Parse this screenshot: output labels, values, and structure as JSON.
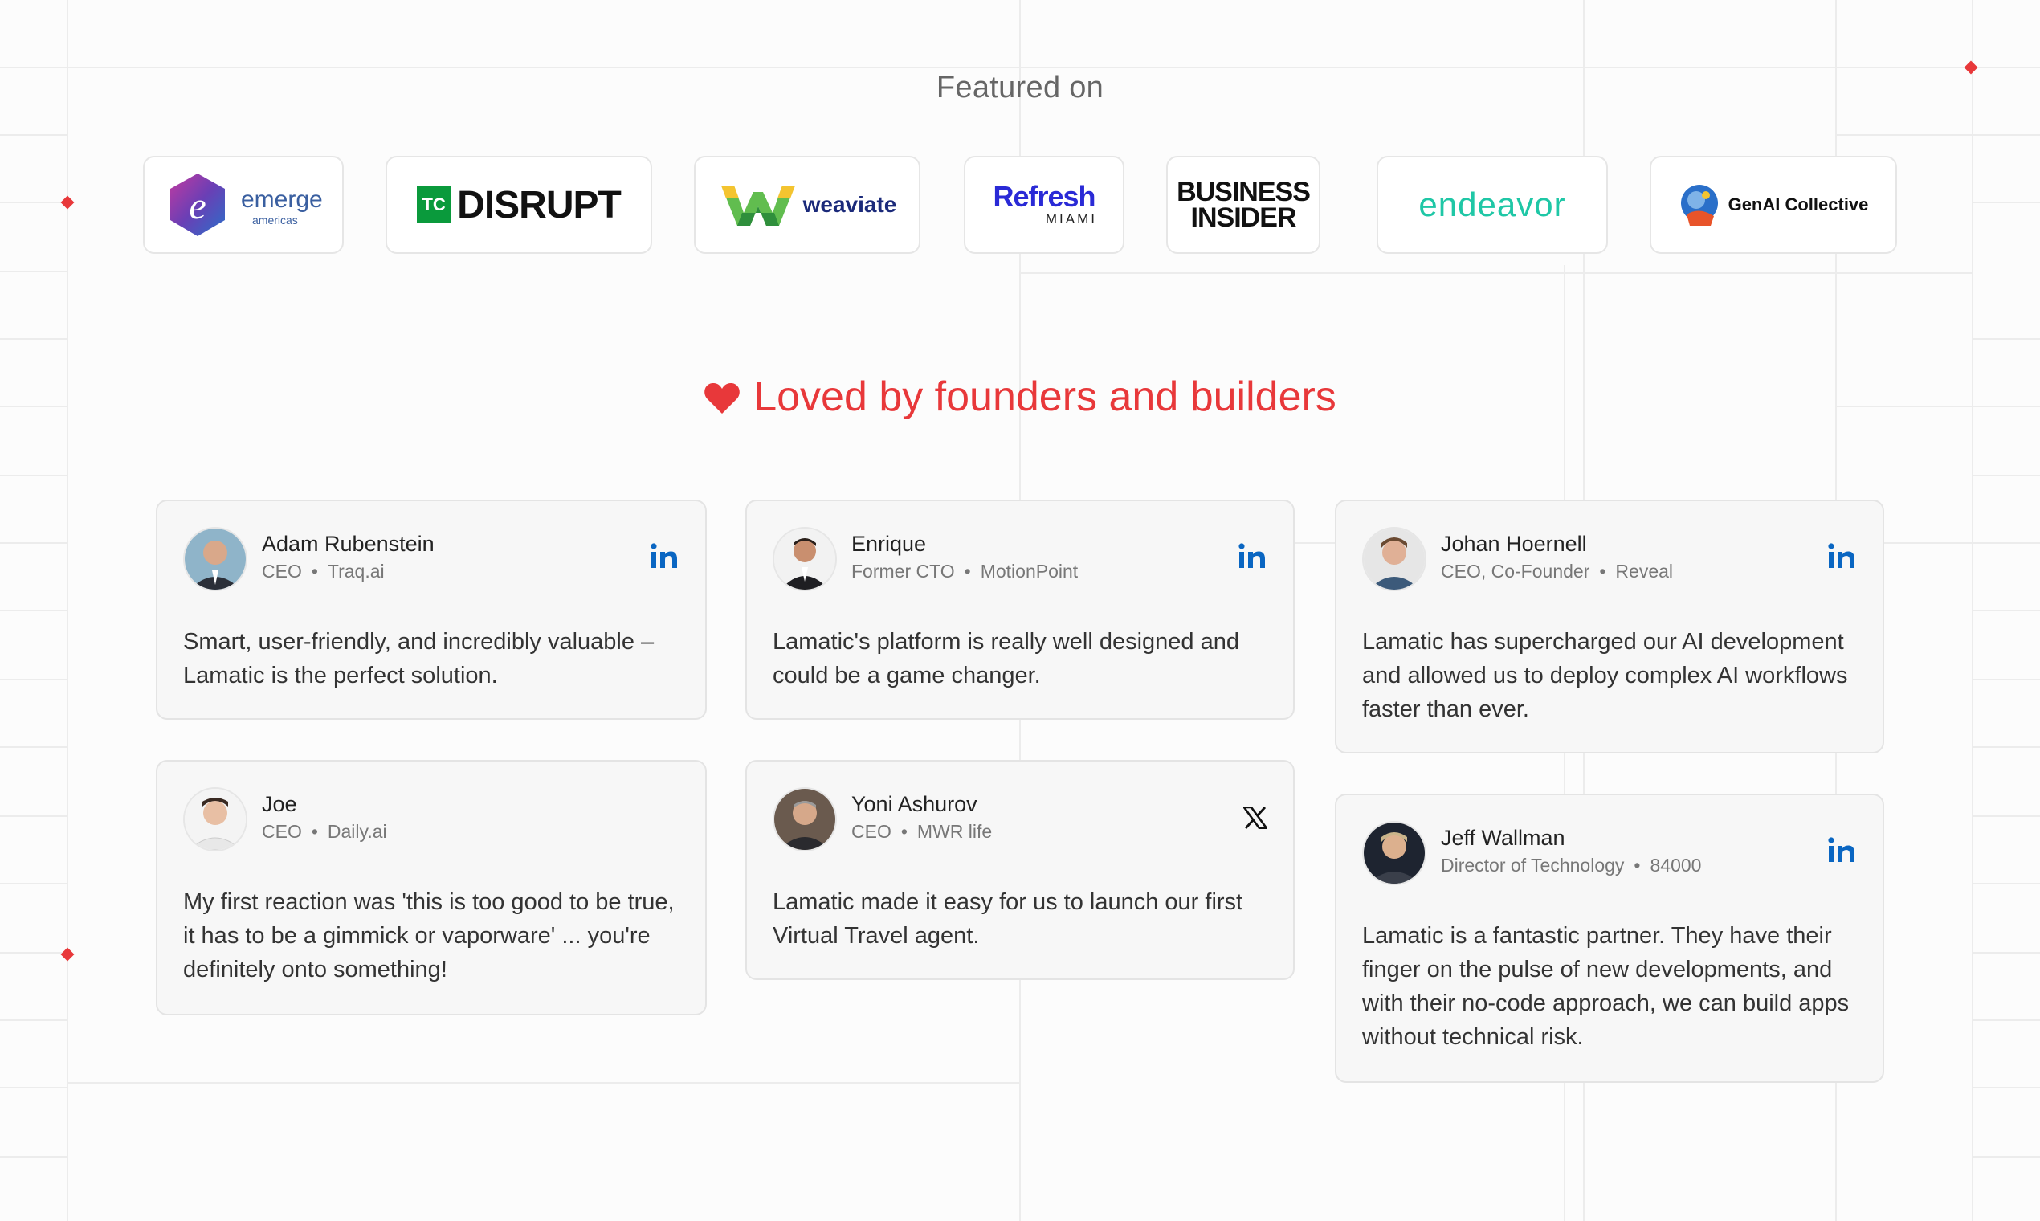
{
  "featured": {
    "title": "Featured on",
    "logos": [
      {
        "name": "emerge",
        "sub": "americas"
      },
      {
        "name": "DISRUPT",
        "badge": "TC"
      },
      {
        "name": "weaviate"
      },
      {
        "name": "Refresh",
        "sub": "MIAMI"
      },
      {
        "name": "BUSINESS",
        "name2": "INSIDER"
      },
      {
        "name": "endeavor"
      },
      {
        "name": "GenAI Collective"
      }
    ]
  },
  "testimonials": {
    "title": "Loved by founders and builders",
    "heart_color": "#e8383a",
    "items": [
      {
        "name": "Adam Rubenstein",
        "role": "CEO",
        "company": "Traq.ai",
        "social": "linkedin",
        "quote": "Smart, user-friendly, and incredibly valuable – Lamatic is the perfect solution."
      },
      {
        "name": "Enrique",
        "role": "Former CTO",
        "company": "MotionPoint",
        "social": "linkedin",
        "quote": "Lamatic's platform is really well designed and could be a game changer."
      },
      {
        "name": "Johan Hoernell",
        "role": "CEO, Co-Founder",
        "company": "Reveal",
        "social": "linkedin",
        "quote": "Lamatic has supercharged our AI development and allowed us to deploy complex AI workflows faster than ever."
      },
      {
        "name": "Joe",
        "role": "CEO",
        "company": "Daily.ai",
        "social": "none",
        "quote": "My first reaction was 'this is too good to be true, it has to be a gimmick or vaporware' ... you're definitely onto something!"
      },
      {
        "name": "Yoni Ashurov",
        "role": "CEO",
        "company": "MWR life",
        "social": "x",
        "quote": "Lamatic made it easy for us to launch our first Virtual Travel agent."
      },
      {
        "name": "Jeff Wallman",
        "role": "Director of Technology",
        "company": "84000",
        "social": "linkedin",
        "quote": "Lamatic is a fantastic partner. They have their finger on the pulse of new developments, and with their no-code approach, we can build apps without technical risk."
      }
    ]
  },
  "colors": {
    "accent": "#e8383a",
    "linkedin": "#0a66c2"
  }
}
